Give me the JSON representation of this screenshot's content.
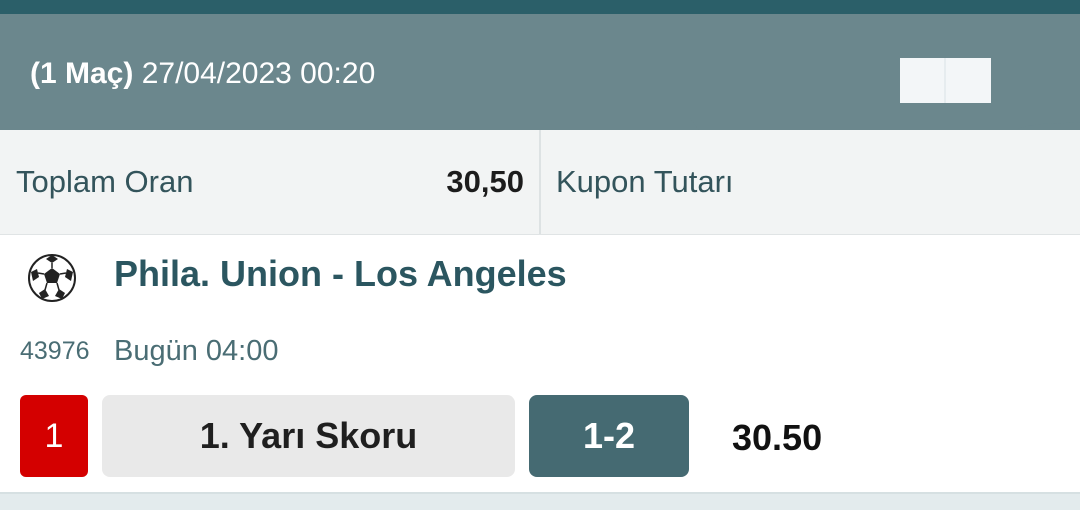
{
  "header": {
    "match_count": "(1 Maç)",
    "datetime": "27/04/2023 00:20"
  },
  "summary": {
    "total_odds_label": "Toplam Oran",
    "total_odds_value": "30,50",
    "coupon_amount_label": "Kupon Tutarı"
  },
  "match": {
    "sport_icon": "soccer-ball-icon",
    "title": "Phila. Union - Los Angeles",
    "code": "43976",
    "time": "Bugün 04:00",
    "selection_number": "1",
    "market": "1. Yarı Skoru",
    "pick": "1-2",
    "odd": "30.50"
  },
  "colors": {
    "topbar": "#2b5f69",
    "header_bg": "#6b878d",
    "accent_teal": "#456a72",
    "selection_red": "#d40000",
    "title_text": "#2b5660"
  }
}
